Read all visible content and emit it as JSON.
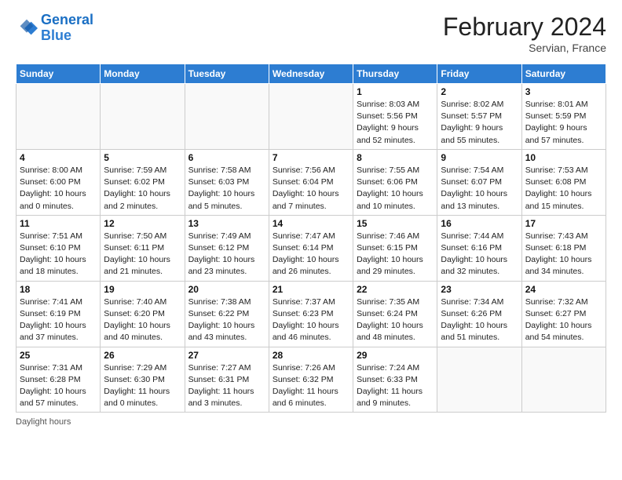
{
  "header": {
    "logo_line1": "General",
    "logo_line2": "Blue",
    "month_title": "February 2024",
    "location": "Servian, France"
  },
  "footer": {
    "daylight_label": "Daylight hours"
  },
  "weekdays": [
    "Sunday",
    "Monday",
    "Tuesday",
    "Wednesday",
    "Thursday",
    "Friday",
    "Saturday"
  ],
  "weeks": [
    [
      {
        "day": "",
        "info": ""
      },
      {
        "day": "",
        "info": ""
      },
      {
        "day": "",
        "info": ""
      },
      {
        "day": "",
        "info": ""
      },
      {
        "day": "1",
        "info": "Sunrise: 8:03 AM\nSunset: 5:56 PM\nDaylight: 9 hours\nand 52 minutes."
      },
      {
        "day": "2",
        "info": "Sunrise: 8:02 AM\nSunset: 5:57 PM\nDaylight: 9 hours\nand 55 minutes."
      },
      {
        "day": "3",
        "info": "Sunrise: 8:01 AM\nSunset: 5:59 PM\nDaylight: 9 hours\nand 57 minutes."
      }
    ],
    [
      {
        "day": "4",
        "info": "Sunrise: 8:00 AM\nSunset: 6:00 PM\nDaylight: 10 hours\nand 0 minutes."
      },
      {
        "day": "5",
        "info": "Sunrise: 7:59 AM\nSunset: 6:02 PM\nDaylight: 10 hours\nand 2 minutes."
      },
      {
        "day": "6",
        "info": "Sunrise: 7:58 AM\nSunset: 6:03 PM\nDaylight: 10 hours\nand 5 minutes."
      },
      {
        "day": "7",
        "info": "Sunrise: 7:56 AM\nSunset: 6:04 PM\nDaylight: 10 hours\nand 7 minutes."
      },
      {
        "day": "8",
        "info": "Sunrise: 7:55 AM\nSunset: 6:06 PM\nDaylight: 10 hours\nand 10 minutes."
      },
      {
        "day": "9",
        "info": "Sunrise: 7:54 AM\nSunset: 6:07 PM\nDaylight: 10 hours\nand 13 minutes."
      },
      {
        "day": "10",
        "info": "Sunrise: 7:53 AM\nSunset: 6:08 PM\nDaylight: 10 hours\nand 15 minutes."
      }
    ],
    [
      {
        "day": "11",
        "info": "Sunrise: 7:51 AM\nSunset: 6:10 PM\nDaylight: 10 hours\nand 18 minutes."
      },
      {
        "day": "12",
        "info": "Sunrise: 7:50 AM\nSunset: 6:11 PM\nDaylight: 10 hours\nand 21 minutes."
      },
      {
        "day": "13",
        "info": "Sunrise: 7:49 AM\nSunset: 6:12 PM\nDaylight: 10 hours\nand 23 minutes."
      },
      {
        "day": "14",
        "info": "Sunrise: 7:47 AM\nSunset: 6:14 PM\nDaylight: 10 hours\nand 26 minutes."
      },
      {
        "day": "15",
        "info": "Sunrise: 7:46 AM\nSunset: 6:15 PM\nDaylight: 10 hours\nand 29 minutes."
      },
      {
        "day": "16",
        "info": "Sunrise: 7:44 AM\nSunset: 6:16 PM\nDaylight: 10 hours\nand 32 minutes."
      },
      {
        "day": "17",
        "info": "Sunrise: 7:43 AM\nSunset: 6:18 PM\nDaylight: 10 hours\nand 34 minutes."
      }
    ],
    [
      {
        "day": "18",
        "info": "Sunrise: 7:41 AM\nSunset: 6:19 PM\nDaylight: 10 hours\nand 37 minutes."
      },
      {
        "day": "19",
        "info": "Sunrise: 7:40 AM\nSunset: 6:20 PM\nDaylight: 10 hours\nand 40 minutes."
      },
      {
        "day": "20",
        "info": "Sunrise: 7:38 AM\nSunset: 6:22 PM\nDaylight: 10 hours\nand 43 minutes."
      },
      {
        "day": "21",
        "info": "Sunrise: 7:37 AM\nSunset: 6:23 PM\nDaylight: 10 hours\nand 46 minutes."
      },
      {
        "day": "22",
        "info": "Sunrise: 7:35 AM\nSunset: 6:24 PM\nDaylight: 10 hours\nand 48 minutes."
      },
      {
        "day": "23",
        "info": "Sunrise: 7:34 AM\nSunset: 6:26 PM\nDaylight: 10 hours\nand 51 minutes."
      },
      {
        "day": "24",
        "info": "Sunrise: 7:32 AM\nSunset: 6:27 PM\nDaylight: 10 hours\nand 54 minutes."
      }
    ],
    [
      {
        "day": "25",
        "info": "Sunrise: 7:31 AM\nSunset: 6:28 PM\nDaylight: 10 hours\nand 57 minutes."
      },
      {
        "day": "26",
        "info": "Sunrise: 7:29 AM\nSunset: 6:30 PM\nDaylight: 11 hours\nand 0 minutes."
      },
      {
        "day": "27",
        "info": "Sunrise: 7:27 AM\nSunset: 6:31 PM\nDaylight: 11 hours\nand 3 minutes."
      },
      {
        "day": "28",
        "info": "Sunrise: 7:26 AM\nSunset: 6:32 PM\nDaylight: 11 hours\nand 6 minutes."
      },
      {
        "day": "29",
        "info": "Sunrise: 7:24 AM\nSunset: 6:33 PM\nDaylight: 11 hours\nand 9 minutes."
      },
      {
        "day": "",
        "info": ""
      },
      {
        "day": "",
        "info": ""
      }
    ]
  ]
}
